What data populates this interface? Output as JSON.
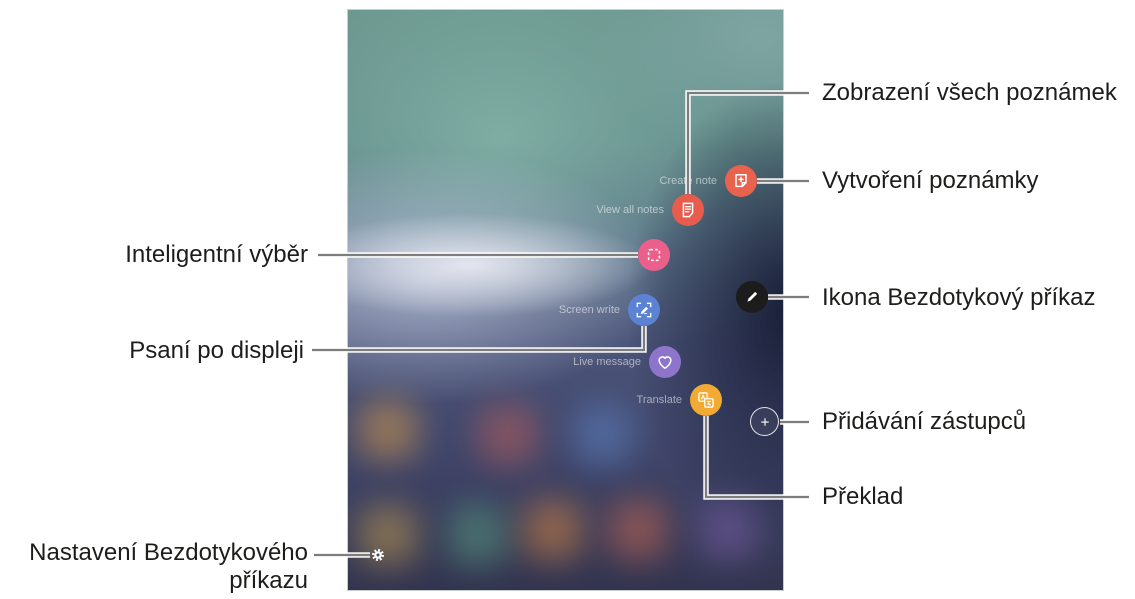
{
  "screen": {
    "air_command": {
      "items": [
        {
          "label": "Create note",
          "icon": "note-plus-icon",
          "color": "#e9624e"
        },
        {
          "label": "View all notes",
          "icon": "notes-list-icon",
          "color": "#e75c4d"
        },
        {
          "icon": "smart-select-icon",
          "color": "#ea608b"
        },
        {
          "label": "Screen write",
          "icon": "screen-write-icon",
          "color": "#5b82d3"
        },
        {
          "label": "Live message",
          "icon": "heart-icon",
          "color": "#8e75cb"
        },
        {
          "label": "Translate",
          "icon": "translate-icon",
          "color": "#f3aa33"
        }
      ],
      "air_command_button": {
        "icon": "pen-icon",
        "color": "#1c1c1c"
      },
      "add_shortcut_button": {
        "icon": "plus-icon"
      },
      "settings_button": {
        "icon": "gear-icon"
      }
    }
  },
  "callouts": {
    "view_all_notes": "Zobrazení všech poznámek",
    "create_note": "Vytvoření poznámky",
    "air_command_icon": "Ikona Bezdotykový příkaz",
    "add_shortcuts": "Přidávání zástupců",
    "translate": "Překlad",
    "smart_select": "Inteligentní výběr",
    "screen_write": "Psaní po displeji",
    "settings": "Nastavení Bezdotykového příkazu"
  },
  "colors": {
    "callout_text": "#1d1d1b",
    "callout_line": "#7d7d7d"
  }
}
